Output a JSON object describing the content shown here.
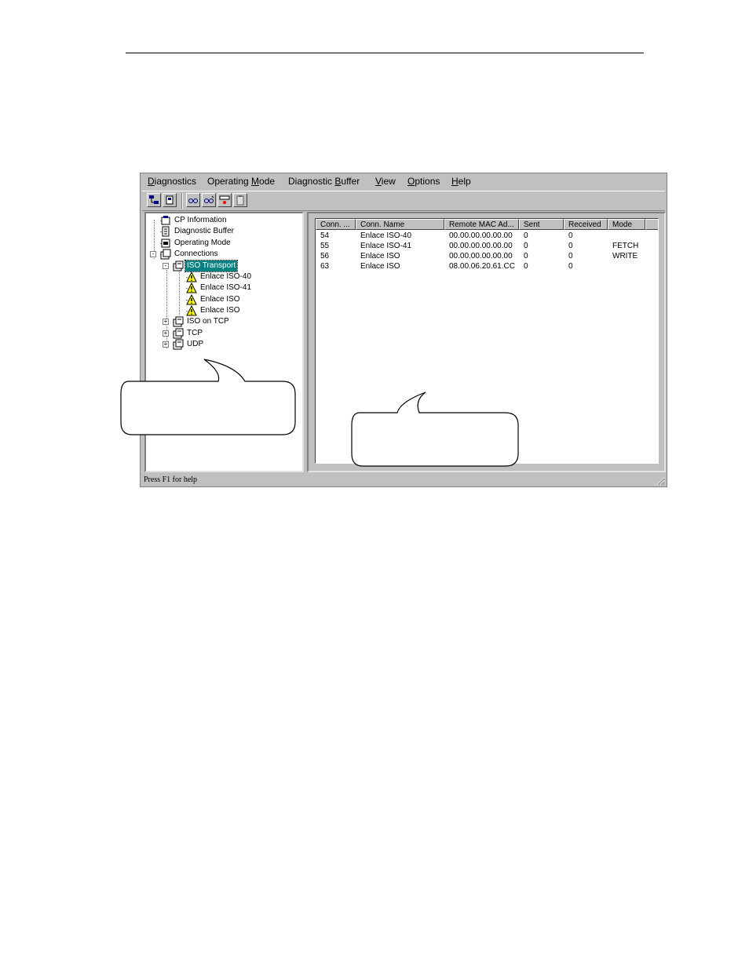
{
  "menu": [
    {
      "label": "Diagnostics",
      "underline_index": 0
    },
    {
      "label": "Operating Mode",
      "underline_index": 10
    },
    {
      "label": "Diagnostic Buffer",
      "underline_index": 11
    },
    {
      "label": "View",
      "underline_index": 0
    },
    {
      "label": "Options",
      "underline_index": 0
    },
    {
      "label": "Help",
      "underline_index": 0
    }
  ],
  "toolbar": {
    "buttons": [
      "network-icon",
      "cpu-icon",
      "glasses-start-icon",
      "glasses-stop-icon",
      "counter-icon",
      "clipboard-icon"
    ]
  },
  "tree": {
    "items": [
      {
        "label": "CP Information",
        "icon": "cp-info-icon"
      },
      {
        "label": "Diagnostic Buffer",
        "icon": "buffer-icon"
      },
      {
        "label": "Operating Mode",
        "icon": "mode-icon"
      },
      {
        "label": "Connections",
        "icon": "connections-icon"
      },
      {
        "label": "ISO Transport",
        "icon": "folder-doc-icon",
        "selected": true
      },
      {
        "label": "Enlace ISO-40",
        "icon": "warning-icon"
      },
      {
        "label": "Enlace ISO-41",
        "icon": "warning-icon"
      },
      {
        "label": "Enlace ISO",
        "icon": "warning-icon"
      },
      {
        "label": "Enlace ISO",
        "icon": "warning-icon"
      },
      {
        "label": "ISO on TCP",
        "icon": "folder-doc-icon"
      },
      {
        "label": "TCP",
        "icon": "folder-doc-icon"
      },
      {
        "label": "UDP",
        "icon": "folder-doc-icon"
      }
    ]
  },
  "table": {
    "columns": [
      "Conn. ...",
      "Conn. Name",
      "Remote MAC Ad...",
      "Sent",
      "Received",
      "Mode"
    ],
    "rows": [
      [
        "54",
        "Enlace ISO-40",
        "00.00.00.00.00.00",
        "0",
        "0",
        ""
      ],
      [
        "55",
        "Enlace ISO-41",
        "00.00.00.00.00.00",
        "0",
        "0",
        "FETCH"
      ],
      [
        "56",
        "Enlace ISO",
        "00.00.00.00.00.00",
        "0",
        "0",
        "WRITE"
      ],
      [
        "63",
        "Enlace ISO",
        "08.00.06.20.61.CC",
        "0",
        "0",
        ""
      ]
    ]
  },
  "status": {
    "text": "Press F1 for help"
  }
}
